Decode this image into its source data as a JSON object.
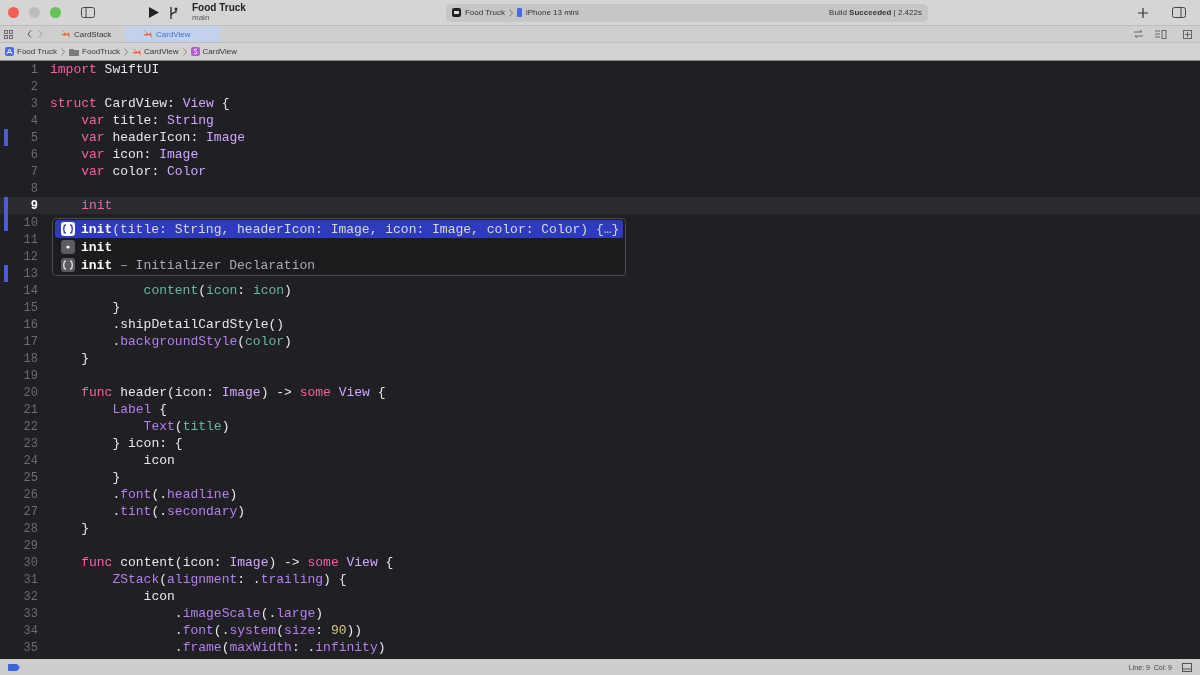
{
  "toolbar": {
    "project": "Food Truck",
    "branch": "main",
    "scheme": "Food Truck",
    "device": "iPhone 13 mini",
    "status": "Build **Succeeded** | 2.422s"
  },
  "tabs": [
    {
      "label": "CardStack",
      "selected": false
    },
    {
      "label": "CardView",
      "selected": true
    }
  ],
  "breadcrumb": [
    {
      "label": "Food Truck",
      "kind": "app"
    },
    {
      "label": "FoodTruck",
      "kind": "folder"
    },
    {
      "label": "CardView",
      "kind": "swift"
    },
    {
      "label": "CardView",
      "kind": "struct"
    }
  ],
  "editor": {
    "lines": [
      {
        "number": "1",
        "current": false,
        "changed": false,
        "tokens": [
          {
            "kind": "keyword",
            "text": "import"
          },
          {
            "kind": "plain",
            "text": " SwiftUI"
          }
        ]
      },
      {
        "number": "2",
        "current": false,
        "changed": false
      },
      {
        "number": "3",
        "current": false,
        "changed": false,
        "tokens": [
          {
            "kind": "keyword",
            "text": "struct"
          },
          {
            "kind": "plain",
            "text": " CardView: "
          },
          {
            "kind": "type",
            "text": "View"
          },
          {
            "kind": "plain",
            "text": " {"
          }
        ]
      },
      {
        "number": "4",
        "current": false,
        "changed": false,
        "tokens": [
          {
            "kind": "keyword",
            "text": "    var"
          },
          {
            "kind": "plain",
            "text": " title: "
          },
          {
            "kind": "type",
            "text": "String"
          }
        ]
      },
      {
        "number": "5",
        "current": false,
        "changed": true,
        "tokens": [
          {
            "kind": "keyword",
            "text": "    var"
          },
          {
            "kind": "plain",
            "text": " headerIcon: "
          },
          {
            "kind": "type",
            "text": "Image"
          }
        ]
      },
      {
        "number": "6",
        "current": false,
        "changed": false,
        "tokens": [
          {
            "kind": "keyword",
            "text": "    var"
          },
          {
            "kind": "plain",
            "text": " icon: "
          },
          {
            "kind": "type",
            "text": "Image"
          }
        ]
      },
      {
        "number": "7",
        "current": false,
        "changed": false,
        "tokens": [
          {
            "kind": "keyword",
            "text": "    var"
          },
          {
            "kind": "plain",
            "text": " color: "
          },
          {
            "kind": "type",
            "text": "Color"
          }
        ]
      },
      {
        "number": "8",
        "current": false,
        "changed": false
      },
      {
        "number": "9",
        "current": true,
        "changed": true,
        "tokens": [
          {
            "kind": "keyword",
            "text": "    init"
          }
        ]
      },
      {
        "number": "10",
        "current": false,
        "changed": true
      },
      {
        "number": "11",
        "current": false,
        "changed": false
      },
      {
        "number": "12",
        "current": false,
        "changed": false
      },
      {
        "number": "13",
        "current": false,
        "changed": true
      },
      {
        "number": "14",
        "current": false,
        "changed": false,
        "tokens": [
          {
            "kind": "local",
            "text": "            content"
          },
          {
            "kind": "plain",
            "text": "("
          },
          {
            "kind": "local",
            "text": "icon"
          },
          {
            "kind": "plain",
            "text": ": "
          },
          {
            "kind": "local",
            "text": "icon"
          },
          {
            "kind": "plain",
            "text": ")"
          }
        ]
      },
      {
        "number": "15",
        "current": false,
        "changed": false,
        "tokens": [
          {
            "kind": "plain",
            "text": "        }"
          }
        ]
      },
      {
        "number": "16",
        "current": false,
        "changed": false,
        "tokens": [
          {
            "kind": "plain",
            "text": "        .shipDetailCardStyle()"
          }
        ]
      },
      {
        "number": "17",
        "current": false,
        "changed": false,
        "tokens": [
          {
            "kind": "plain",
            "text": "        ."
          },
          {
            "kind": "member",
            "text": "backgroundStyle"
          },
          {
            "kind": "plain",
            "text": "("
          },
          {
            "kind": "local",
            "text": "color"
          },
          {
            "kind": "plain",
            "text": ")"
          }
        ]
      },
      {
        "number": "18",
        "current": false,
        "changed": false,
        "tokens": [
          {
            "kind": "plain",
            "text": "    }"
          }
        ]
      },
      {
        "number": "19",
        "current": false,
        "changed": false
      },
      {
        "number": "20",
        "current": false,
        "changed": false,
        "tokens": [
          {
            "kind": "keyword",
            "text": "    func"
          },
          {
            "kind": "plain",
            "text": " header(icon: "
          },
          {
            "kind": "type",
            "text": "Image"
          },
          {
            "kind": "plain",
            "text": ") -> "
          },
          {
            "kind": "keyword",
            "text": "some"
          },
          {
            "kind": "type",
            "text": " View"
          },
          {
            "kind": "plain",
            "text": " {"
          }
        ]
      },
      {
        "number": "21",
        "current": false,
        "changed": false,
        "tokens": [
          {
            "kind": "member",
            "text": "        Label"
          },
          {
            "kind": "plain",
            "text": " {"
          }
        ]
      },
      {
        "number": "22",
        "current": false,
        "changed": false,
        "tokens": [
          {
            "kind": "member",
            "text": "            Text"
          },
          {
            "kind": "plain",
            "text": "("
          },
          {
            "kind": "local",
            "text": "title"
          },
          {
            "kind": "plain",
            "text": ")"
          }
        ]
      },
      {
        "number": "23",
        "current": false,
        "changed": false,
        "tokens": [
          {
            "kind": "plain",
            "text": "        } icon: {"
          }
        ]
      },
      {
        "number": "24",
        "current": false,
        "changed": false,
        "tokens": [
          {
            "kind": "plain",
            "text": "            icon"
          }
        ]
      },
      {
        "number": "25",
        "current": false,
        "changed": false,
        "tokens": [
          {
            "kind": "plain",
            "text": "        }"
          }
        ]
      },
      {
        "number": "26",
        "current": false,
        "changed": false,
        "tokens": [
          {
            "kind": "plain",
            "text": "        ."
          },
          {
            "kind": "member",
            "text": "font"
          },
          {
            "kind": "plain",
            "text": "(."
          },
          {
            "kind": "member",
            "text": "headline"
          },
          {
            "kind": "plain",
            "text": ")"
          }
        ]
      },
      {
        "number": "27",
        "current": false,
        "changed": false,
        "tokens": [
          {
            "kind": "plain",
            "text": "        ."
          },
          {
            "kind": "member",
            "text": "tint"
          },
          {
            "kind": "plain",
            "text": "(."
          },
          {
            "kind": "member",
            "text": "secondary"
          },
          {
            "kind": "plain",
            "text": ")"
          }
        ]
      },
      {
        "number": "28",
        "current": false,
        "changed": false,
        "tokens": [
          {
            "kind": "plain",
            "text": "    }"
          }
        ]
      },
      {
        "number": "29",
        "current": false,
        "changed": false
      },
      {
        "number": "30",
        "current": false,
        "changed": false,
        "tokens": [
          {
            "kind": "keyword",
            "text": "    func"
          },
          {
            "kind": "plain",
            "text": " content(icon: "
          },
          {
            "kind": "type",
            "text": "Image"
          },
          {
            "kind": "plain",
            "text": ") -> "
          },
          {
            "kind": "keyword",
            "text": "some"
          },
          {
            "kind": "type",
            "text": " View"
          },
          {
            "kind": "plain",
            "text": " {"
          }
        ]
      },
      {
        "number": "31",
        "current": false,
        "changed": false,
        "tokens": [
          {
            "kind": "member",
            "text": "        ZStack"
          },
          {
            "kind": "plain",
            "text": "("
          },
          {
            "kind": "member",
            "text": "alignment"
          },
          {
            "kind": "plain",
            "text": ": ."
          },
          {
            "kind": "member",
            "text": "trailing"
          },
          {
            "kind": "plain",
            "text": ") {"
          }
        ]
      },
      {
        "number": "32",
        "current": false,
        "changed": false,
        "tokens": [
          {
            "kind": "plain",
            "text": "            icon"
          }
        ]
      },
      {
        "number": "33",
        "current": false,
        "changed": false,
        "tokens": [
          {
            "kind": "plain",
            "text": "                ."
          },
          {
            "kind": "member",
            "text": "imageScale"
          },
          {
            "kind": "plain",
            "text": "(."
          },
          {
            "kind": "member",
            "text": "large"
          },
          {
            "kind": "plain",
            "text": ")"
          }
        ]
      },
      {
        "number": "34",
        "current": false,
        "changed": false,
        "tokens": [
          {
            "kind": "plain",
            "text": "                ."
          },
          {
            "kind": "member",
            "text": "font"
          },
          {
            "kind": "plain",
            "text": "(."
          },
          {
            "kind": "member",
            "text": "system"
          },
          {
            "kind": "plain",
            "text": "("
          },
          {
            "kind": "member",
            "text": "size"
          },
          {
            "kind": "plain",
            "text": ": "
          },
          {
            "kind": "number",
            "text": "90"
          },
          {
            "kind": "plain",
            "text": "))"
          }
        ]
      },
      {
        "number": "35",
        "current": false,
        "changed": false,
        "tokens": [
          {
            "kind": "plain",
            "text": "                ."
          },
          {
            "kind": "member",
            "text": "frame"
          },
          {
            "kind": "plain",
            "text": "("
          },
          {
            "kind": "member",
            "text": "maxWidth"
          },
          {
            "kind": "plain",
            "text": ": ."
          },
          {
            "kind": "member",
            "text": "infinity"
          },
          {
            "kind": "plain",
            "text": ")"
          }
        ]
      }
    ]
  },
  "completions": [
    {
      "kind": "method",
      "name": "init",
      "detail": "(title: String, headerIcon: Image, icon: Image, color: Color) {…}",
      "selected": true
    },
    {
      "kind": "keyword",
      "name": "init",
      "selected": false
    },
    {
      "kind": "snippet",
      "name": "init",
      "detail": " – Initializer Declaration",
      "selected": false
    }
  ],
  "status_bar": {
    "position": "Line: 9  Col: 9"
  }
}
